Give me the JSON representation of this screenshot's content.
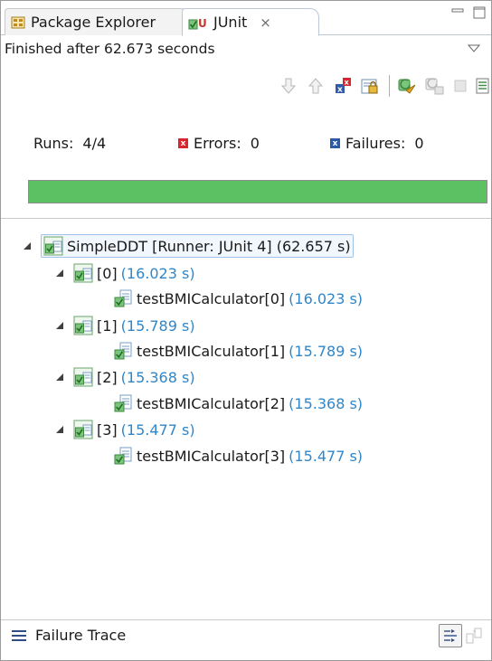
{
  "tabs": [
    {
      "label": "Package Explorer",
      "icon": "package-explorer-icon",
      "active": false
    },
    {
      "label": "JUnit",
      "icon": "junit-icon",
      "active": true,
      "close_glyph": "⨯"
    }
  ],
  "status": {
    "text": "Finished after 62.673 seconds"
  },
  "counters": {
    "runs_label": "Runs:",
    "runs_value": "4/4",
    "errors_label": "Errors:",
    "errors_value": "0",
    "failures_label": "Failures:",
    "failures_value": "0"
  },
  "progress": {
    "fraction": 1.0,
    "color": "#5cc163"
  },
  "tree": {
    "root": {
      "label": "SimpleDDT [Runner: JUnit 4] (62.657 s)"
    },
    "groups": [
      {
        "label": "[0]",
        "time": "(16.023 s)",
        "child": {
          "label": "testBMICalculator[0]",
          "time": "(16.023 s)"
        }
      },
      {
        "label": "[1]",
        "time": "(15.789 s)",
        "child": {
          "label": "testBMICalculator[1]",
          "time": "(15.789 s)"
        }
      },
      {
        "label": "[2]",
        "time": "(15.368 s)",
        "child": {
          "label": "testBMICalculator[2]",
          "time": "(15.368 s)"
        }
      },
      {
        "label": "[3]",
        "time": "(15.477 s)",
        "child": {
          "label": "testBMICalculator[3]",
          "time": "(15.477 s)"
        }
      }
    ]
  },
  "trace": {
    "label": "Failure Trace"
  },
  "colors": {
    "success": "#5cc163",
    "time_text": "#2f86c8",
    "error_red": "#d9262c",
    "failure_blue": "#2b5aa8",
    "selection_border": "#9fc3e6"
  }
}
